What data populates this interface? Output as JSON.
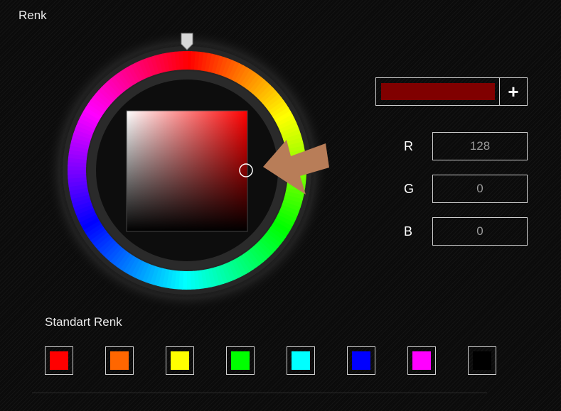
{
  "title": "Renk",
  "current_color": "#800000",
  "add_label": "+",
  "channels": [
    {
      "label": "R",
      "value": "128"
    },
    {
      "label": "G",
      "value": "0"
    },
    {
      "label": "B",
      "value": "0"
    }
  ],
  "standard_title": "Standart Renk",
  "standard_colors": [
    "#ff0000",
    "#ff6600",
    "#ffff00",
    "#00ff00",
    "#00ffff",
    "#0000ff",
    "#ff00ff",
    "#000000"
  ],
  "hue_base": "#ff0000",
  "annotation_arrow_color": "#b87d58"
}
